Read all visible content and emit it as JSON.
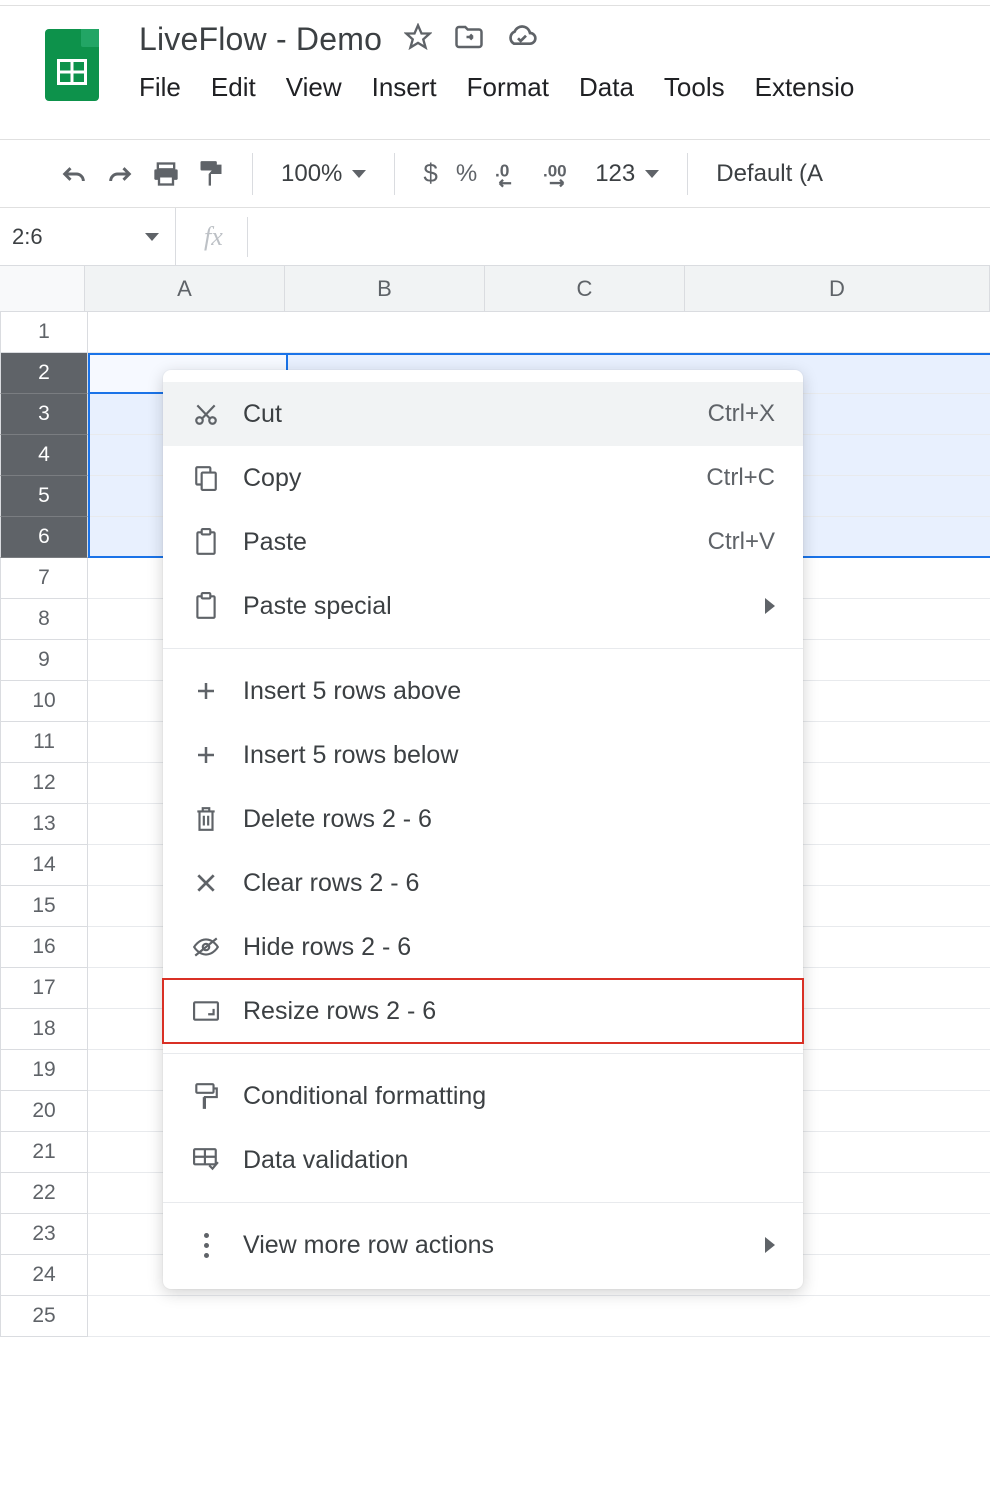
{
  "doc": {
    "title": "LiveFlow - Demo"
  },
  "menubar": {
    "file": "File",
    "edit": "Edit",
    "view": "View",
    "insert": "Insert",
    "format": "Format",
    "data": "Data",
    "tools": "Tools",
    "extensions": "Extensio"
  },
  "toolbar": {
    "zoom": "100%",
    "morefmt": "123",
    "font": "Default (A"
  },
  "namebox": "2:6",
  "fx_symbol": "fx",
  "columns": [
    "A",
    "B",
    "C",
    "D"
  ],
  "row_count": 25,
  "selected_rows": [
    2,
    3,
    4,
    5,
    6
  ],
  "ctx": {
    "cut": {
      "label": "Cut",
      "shortcut": "Ctrl+X"
    },
    "copy": {
      "label": "Copy",
      "shortcut": "Ctrl+C"
    },
    "paste": {
      "label": "Paste",
      "shortcut": "Ctrl+V"
    },
    "paste_special": {
      "label": "Paste special"
    },
    "insert_above": {
      "label": "Insert 5 rows above"
    },
    "insert_below": {
      "label": "Insert 5 rows below"
    },
    "delete": {
      "label": "Delete rows 2 - 6"
    },
    "clear": {
      "label": "Clear rows 2 - 6"
    },
    "hide": {
      "label": "Hide rows 2 - 6"
    },
    "resize": {
      "label": "Resize rows 2 - 6"
    },
    "cond_fmt": {
      "label": "Conditional formatting"
    },
    "data_val": {
      "label": "Data validation"
    },
    "more": {
      "label": "View more row actions"
    }
  }
}
